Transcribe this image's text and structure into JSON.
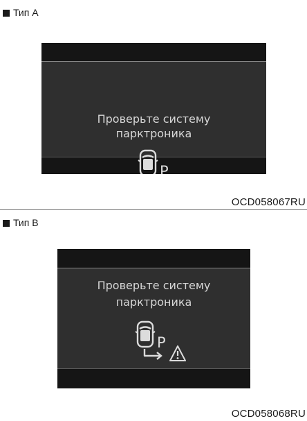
{
  "panels": [
    {
      "label": "Тип A",
      "message_line1": "Проверьте систему",
      "message_line2": "парктроника",
      "park_symbol": "P",
      "icon": "parking-sensor-car-icon",
      "code": "OCD058067RU"
    },
    {
      "label": "Тип B",
      "message_line1": "Проверьте систему",
      "message_line2": "парктроника",
      "park_symbol": "P",
      "icon": "parking-sensor-car-warning-icon",
      "code": "OCD058068RU"
    }
  ],
  "colors": {
    "display_background": "#151515",
    "display_center": "#2f2f2f",
    "display_text": "#d6d6d6"
  }
}
